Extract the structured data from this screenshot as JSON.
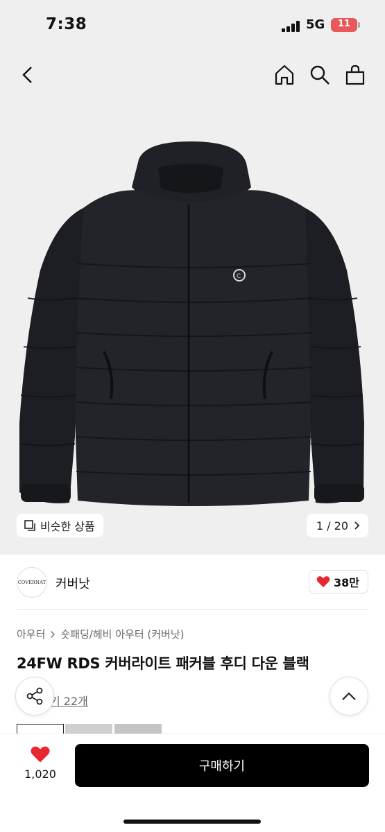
{
  "status_bar": {
    "time": "7:38",
    "network": "5G",
    "battery": "11"
  },
  "hero": {
    "similar_label": "비슷한 상품",
    "counter": "1 / 20"
  },
  "seller": {
    "logo_text": "COVERNAT",
    "name": "커버낫",
    "likes": "38만"
  },
  "product": {
    "breadcrumb": [
      "아우터",
      "숏패딩/헤비 아우터 (커버낫)"
    ],
    "title": "24FW RDS 커버라이트 패커블 후디 다운 블랙",
    "review_link": "기 22개"
  },
  "bottom_bar": {
    "wish_count": "1,020",
    "buy_label": "구매하기"
  },
  "colors": {
    "accent": "#000000",
    "heart": "#e8262f",
    "battery": "#e85a5a"
  }
}
